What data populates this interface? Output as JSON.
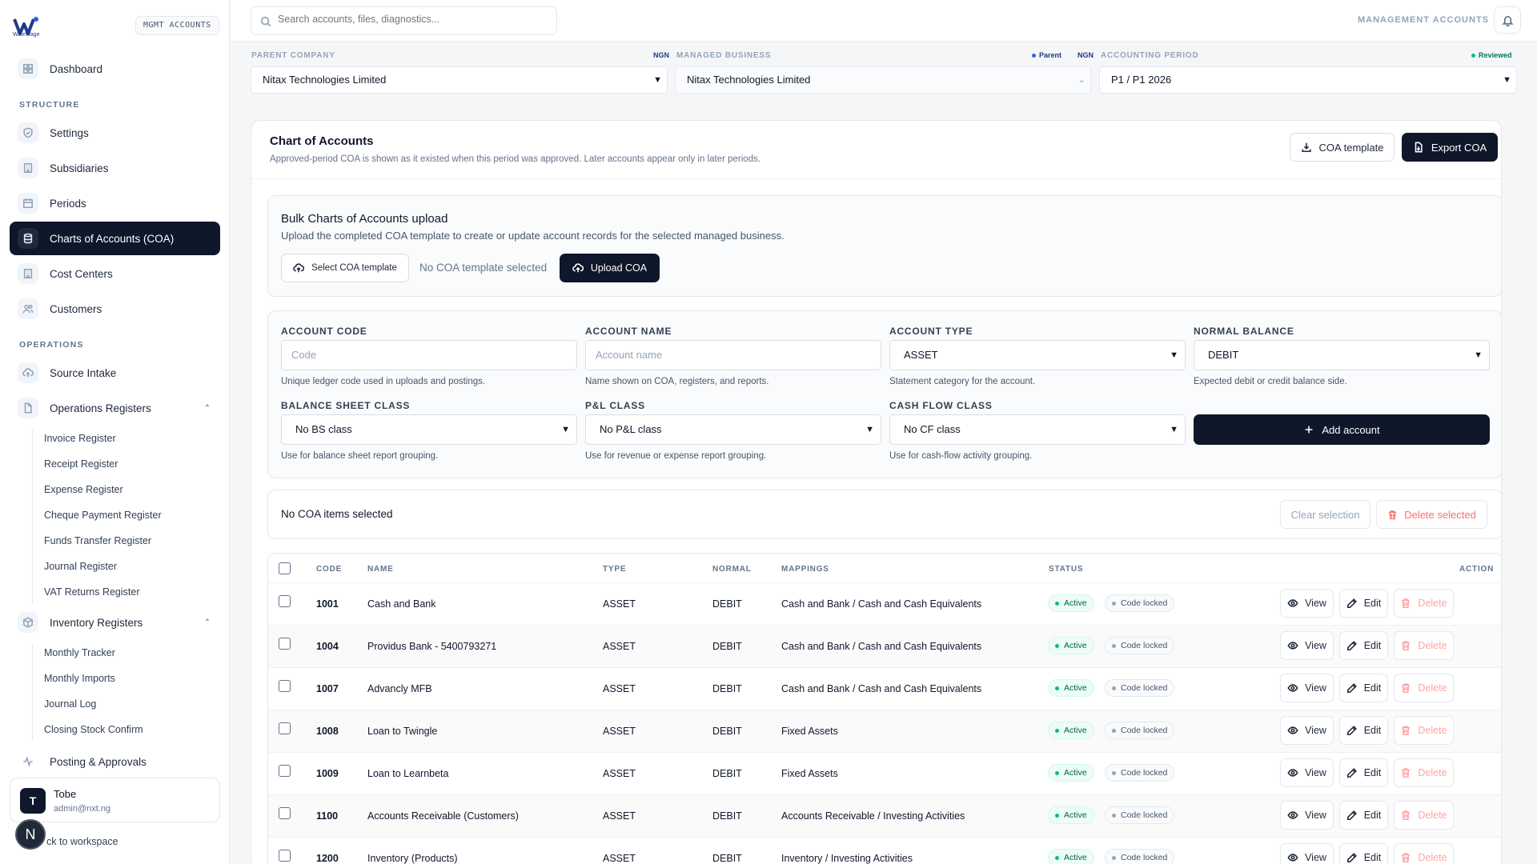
{
  "sidebar": {
    "logo_text": "WiseWage",
    "badge": "MGMT ACCOUNTS",
    "dashboard": "Dashboard",
    "section_structure": "STRUCTURE",
    "settings": "Settings",
    "subsidiaries": "Subsidiaries",
    "periods": "Periods",
    "coa": "Charts of Accounts (COA)",
    "cost_centers": "Cost Centers",
    "customers": "Customers",
    "section_operations": "OPERATIONS",
    "source_intake": "Source Intake",
    "operations_registers": "Operations Registers",
    "op_items": [
      "Invoice Register",
      "Receipt Register",
      "Expense Register",
      "Cheque Payment Register",
      "Funds Transfer Register",
      "Journal Register",
      "VAT Returns Register"
    ],
    "inventory_registers": "Inventory Registers",
    "inv_items": [
      "Monthly Tracker",
      "Monthly Imports",
      "Journal Log",
      "Closing Stock Confirm"
    ],
    "posting": "Posting & Approvals",
    "user": {
      "initial": "T",
      "name": "Tobe",
      "email": "admin@nxt.ng"
    },
    "back": "ck to workspace",
    "n_badge": "N"
  },
  "topbar": {
    "search_placeholder": "Search accounts, files, diagnostics...",
    "mode": "MANAGEMENT ACCOUNTS"
  },
  "context": {
    "parent_label": "PARENT COMPANY",
    "parent_currency": "NGN",
    "parent_value": "Nitax Technologies Limited",
    "managed_label": "MANAGED BUSINESS",
    "managed_tag": "Parent",
    "managed_currency": "NGN",
    "managed_value": "Nitax Technologies Limited",
    "period_label": "ACCOUNTING PERIOD",
    "period_tag": "Reviewed",
    "period_value": "P1 / P1 2026"
  },
  "coa": {
    "title": "Chart of Accounts",
    "subtitle": "Approved-period COA is shown as it existed when this period was approved. Later accounts appear only in later periods.",
    "template_btn": "COA template",
    "export_btn": "Export COA",
    "bulk_title": "Bulk Charts of Accounts upload",
    "bulk_sub": "Upload the completed COA template to create or update account records for the selected managed business.",
    "select_btn": "Select COA template",
    "no_template": "No COA template selected",
    "upload_btn": "Upload COA"
  },
  "form": {
    "code_label": "ACCOUNT CODE",
    "code_placeholder": "Code",
    "code_help": "Unique ledger code used in uploads and postings.",
    "name_label": "ACCOUNT NAME",
    "name_placeholder": "Account name",
    "name_help": "Name shown on COA, registers, and reports.",
    "type_label": "ACCOUNT TYPE",
    "type_value": "ASSET",
    "type_help": "Statement category for the account.",
    "balance_label": "NORMAL BALANCE",
    "balance_value": "DEBIT",
    "balance_help": "Expected debit or credit balance side.",
    "bs_label": "BALANCE SHEET CLASS",
    "bs_value": "No BS class",
    "bs_help": "Use for balance sheet report grouping.",
    "pl_label": "P&L CLASS",
    "pl_value": "No P&L class",
    "pl_help": "Use for revenue or expense report grouping.",
    "cf_label": "CASH FLOW CLASS",
    "cf_value": "No CF class",
    "cf_help": "Use for cash-flow activity grouping.",
    "add_btn": "Add account"
  },
  "selection": {
    "text": "No COA items selected",
    "clear_btn": "Clear selection",
    "delete_btn": "Delete selected"
  },
  "table": {
    "headers": {
      "code": "CODE",
      "name": "NAME",
      "type": "TYPE",
      "normal": "NORMAL",
      "mappings": "MAPPINGS",
      "status": "STATUS",
      "action": "ACTION"
    },
    "actions": {
      "view": "View",
      "edit": "Edit",
      "delete": "Delete"
    },
    "rows": [
      {
        "code": "1001",
        "name": "Cash and Bank",
        "type": "ASSET",
        "normal": "DEBIT",
        "mapping": "Cash and Bank / Cash and Cash Equivalents",
        "status": "Active",
        "lock": "Code locked"
      },
      {
        "code": "1004",
        "name": "Providus Bank - 5400793271",
        "type": "ASSET",
        "normal": "DEBIT",
        "mapping": "Cash and Bank / Cash and Cash Equivalents",
        "status": "Active",
        "lock": "Code locked"
      },
      {
        "code": "1007",
        "name": "Advancly MFB",
        "type": "ASSET",
        "normal": "DEBIT",
        "mapping": "Cash and Bank / Cash and Cash Equivalents",
        "status": "Active",
        "lock": "Code locked"
      },
      {
        "code": "1008",
        "name": "Loan to Twingle",
        "type": "ASSET",
        "normal": "DEBIT",
        "mapping": "Fixed Assets",
        "status": "Active",
        "lock": "Code locked"
      },
      {
        "code": "1009",
        "name": "Loan to Learnbeta",
        "type": "ASSET",
        "normal": "DEBIT",
        "mapping": "Fixed Assets",
        "status": "Active",
        "lock": "Code locked"
      },
      {
        "code": "1100",
        "name": "Accounts Receivable (Customers)",
        "type": "ASSET",
        "normal": "DEBIT",
        "mapping": "Accounts Receivable / Investing Activities",
        "status": "Active",
        "lock": "Code locked"
      },
      {
        "code": "1200",
        "name": "Inventory (Products)",
        "type": "ASSET",
        "normal": "DEBIT",
        "mapping": "Inventory / Investing Activities",
        "status": "Active",
        "lock": "Code locked"
      }
    ]
  }
}
